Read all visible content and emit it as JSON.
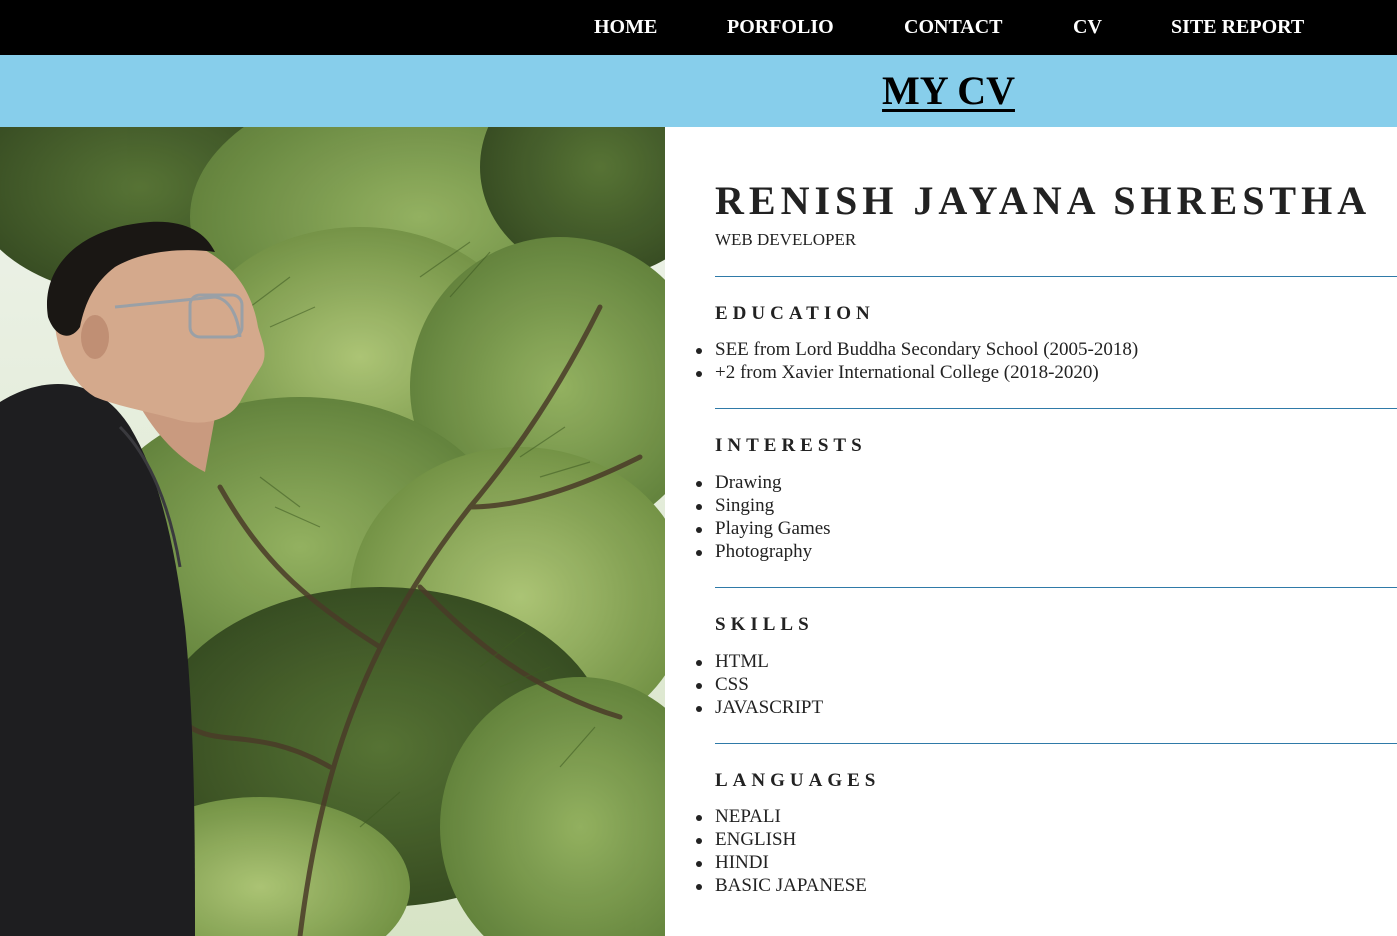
{
  "nav": {
    "items": [
      "HOME",
      "PORFOLIO",
      "CONTACT",
      "CV",
      "SITE REPORT"
    ]
  },
  "banner": {
    "title": "MY CV"
  },
  "profile": {
    "name": "RENISH JAYANA SHRESTHA",
    "role": "WEB DEVELOPER"
  },
  "sections": {
    "education": {
      "title": "EDUCATION",
      "items": [
        "SEE from Lord Buddha Secondary School (2005-2018)",
        "+2 from Xavier International College (2018-2020)"
      ]
    },
    "interests": {
      "title": "INTERESTS",
      "items": [
        "Drawing",
        "Singing",
        "Playing Games",
        "Photography"
      ]
    },
    "skills": {
      "title": "SKILLS",
      "items": [
        "HTML",
        "CSS",
        "JAVASCRIPT"
      ]
    },
    "languages": {
      "title": "LANGUAGES",
      "items": [
        "NEPALI",
        "ENGLISH",
        "HINDI",
        "BASIC JAPANESE"
      ]
    }
  },
  "colors": {
    "nav_bg": "#000000",
    "band_bg": "#87ceeb",
    "rule": "#2f7aa8",
    "text": "#222222"
  }
}
